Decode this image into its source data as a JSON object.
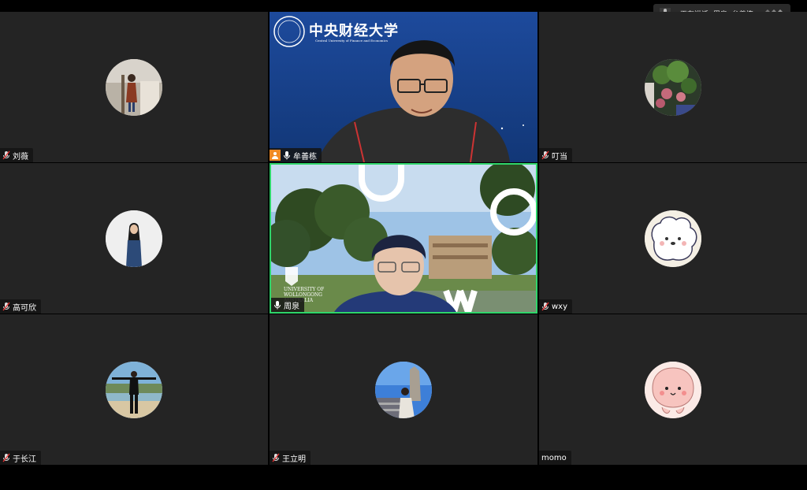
{
  "speaking_indicator": {
    "text": "正在讲话: 周泉; 牟善栋;"
  },
  "participants": [
    {
      "name": "刘薇"
    },
    {
      "name": "牟善栋"
    },
    {
      "name": "叮当"
    },
    {
      "name": "高可欣"
    },
    {
      "name": "周泉"
    },
    {
      "name": "wxy"
    },
    {
      "name": "于长江"
    },
    {
      "name": "王立明"
    },
    {
      "name": "momo"
    }
  ],
  "video_backgrounds": {
    "cufe_name_cn": "中央财经大学",
    "cufe_name_en": "Central University of Finance and Economics",
    "uow_name": "UNIVERSITY OF WOLLONGONG AUSTRALIA"
  },
  "colors": {
    "active_border": "#2fd56a",
    "host_badge": "#f08a24",
    "tile_bg": "#242424"
  }
}
